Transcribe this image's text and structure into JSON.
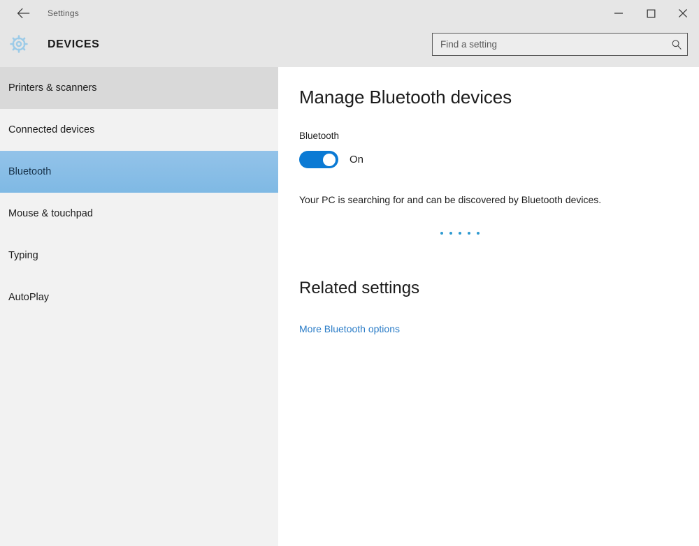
{
  "titlebar": {
    "back_icon": "back-arrow-icon",
    "app_title": "Settings",
    "minimize_label": "–",
    "maximize_label": "□",
    "close_label": "×"
  },
  "header": {
    "gear_icon": "gear-icon",
    "title": "DEVICES",
    "accent_color": "#0b7ad4"
  },
  "search": {
    "placeholder": "Find a setting",
    "value": "",
    "icon": "search-icon"
  },
  "sidebar": {
    "items": [
      {
        "label": "Printers & scanners",
        "state": "hovered"
      },
      {
        "label": "Connected devices",
        "state": "normal"
      },
      {
        "label": "Bluetooth",
        "state": "selected"
      },
      {
        "label": "Mouse & touchpad",
        "state": "normal"
      },
      {
        "label": "Typing",
        "state": "normal"
      },
      {
        "label": "AutoPlay",
        "state": "normal"
      }
    ],
    "selected_color": "#8bbfe6",
    "hover_color": "#d9d9d9",
    "background_color": "#f2f2f2"
  },
  "main": {
    "heading": "Manage Bluetooth devices",
    "bluetooth_label": "Bluetooth",
    "toggle": {
      "state_label": "On",
      "checked": true,
      "on_color": "#0b7ad4"
    },
    "status_text": "Your PC is searching for and can be discovered by Bluetooth devices.",
    "progress_dots": 5,
    "progress_dot_color": "#2f9ad0",
    "related_heading": "Related settings",
    "related_link": "More Bluetooth options",
    "link_color": "#2a7cc7"
  }
}
